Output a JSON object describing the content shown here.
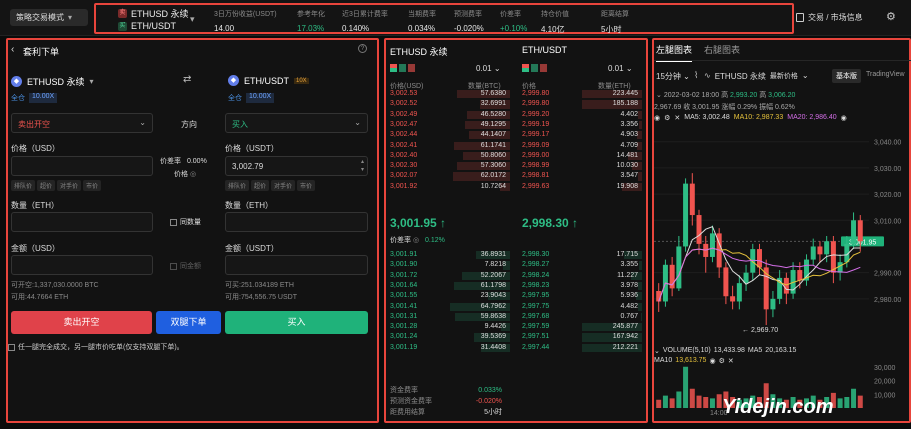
{
  "topbar": {
    "mode": "策略交易模式",
    "pair1_tag": "卖",
    "pair1": "ETHUSD 永续",
    "pair2_tag": "买",
    "pair2": "ETH/USDT",
    "stats": [
      {
        "label": "3日万份收益(USDT)",
        "value": "14.00",
        "color": "#e8e8e8"
      },
      {
        "label": "参考年化",
        "value": "17.03%",
        "color": "#2ebd85"
      },
      {
        "label": "近3日累计费率",
        "value": "0.140%",
        "color": "#e8e8e8"
      },
      {
        "label": "当期费率",
        "value": "0.034%",
        "color": "#e8e8e8"
      },
      {
        "label": "预测费率",
        "value": "-0.020%",
        "color": "#e8e8e8"
      },
      {
        "label": "价差率",
        "value": "+0.10%",
        "color": "#2ebd85"
      },
      {
        "label": "持仓价值",
        "value": "4.10亿",
        "color": "#e8e8e8"
      },
      {
        "label": "距离结算",
        "value": "5小时",
        "color": "#e8e8e8"
      }
    ],
    "market_info": "交易 / 市场信息"
  },
  "order": {
    "title": "套利下单",
    "left_pair": "ETHUSD 永续",
    "left_mode": "全仓",
    "left_lev": "10.00X",
    "right_pair": "ETH/USDT",
    "right_lev_badge": "10X",
    "right_mode": "全仓",
    "right_lev": "10.00X",
    "left_direction": "卖出开空",
    "direction_label": "方向",
    "right_direction": "买入",
    "left_price_label": "价格（USD）",
    "spread_label": "价差率",
    "spread_value": "0.00%",
    "price_label2": "价格",
    "right_price_label": "价格（USDT）",
    "right_price_value": "3,002.79",
    "left_chips": [
      "排队价",
      "超价",
      "对手价",
      "市价"
    ],
    "right_chips": [
      "排队价",
      "超价",
      "对手价",
      "市价"
    ],
    "left_qty_label": "数量（ETH）",
    "same_qty": "同数量",
    "right_qty_label": "数量（ETH）",
    "left_amt_label": "金额（USD）",
    "same_amt": "同金额",
    "right_amt_label": "金额（USDT）",
    "left_avail1": "可开空:1,337,030.0000 BTC",
    "left_avail2": "可用:44.7664 ETH",
    "right_avail1": "可买:251.034189 ETH",
    "right_avail2": "可用:754,556.75 USDT",
    "btn_sell": "卖出开空",
    "btn_both": "双腿下单",
    "btn_buy": "买入",
    "note": "任一腿完全成交，另一腿市价吃单(仅支持双腿下单)。"
  },
  "orderbook": {
    "left_title": "ETHUSD 永续",
    "right_title": "ETH/USDT",
    "left_step": "0.01",
    "right_step": "0.01",
    "left_price_hdr": "价格(USD)",
    "left_qty_hdr": "数量(BTC)",
    "right_price_hdr": "价格",
    "right_qty_hdr": "数量(ETH)",
    "left_asks": [
      [
        "3,002.53",
        "57.6380"
      ],
      [
        "3,002.52",
        "32.6991"
      ],
      [
        "3,002.49",
        "46.5280"
      ],
      [
        "3,002.47",
        "49.1295"
      ],
      [
        "3,002.44",
        "44.1407"
      ],
      [
        "3,002.41",
        "61.1741"
      ],
      [
        "3,002.40",
        "50.8060"
      ],
      [
        "3,002.30",
        "57.3060"
      ],
      [
        "3,002.07",
        "62.0172"
      ],
      [
        "3,001.92",
        "10.7264"
      ]
    ],
    "right_asks": [
      [
        "2,999.80",
        "223.445"
      ],
      [
        "2,999.80",
        "185.188"
      ],
      [
        "2,999.20",
        "4.402"
      ],
      [
        "2,999.19",
        "3.356"
      ],
      [
        "2,999.17",
        "4.903"
      ],
      [
        "2,999.09",
        "4.709"
      ],
      [
        "2,999.00",
        "14.481"
      ],
      [
        "2,998.99",
        "10.030"
      ],
      [
        "2,998.81",
        "3.547"
      ],
      [
        "2,999.63",
        "19.908"
      ]
    ],
    "left_last": "3,001.95 ↑",
    "right_last": "2,998.30 ↑",
    "spread_label": "价差率",
    "spread_value": "0.12%",
    "left_bids": [
      [
        "3,001.91",
        "36.8931"
      ],
      [
        "3,001.90",
        "7.8218"
      ],
      [
        "3,001.72",
        "52.2067"
      ],
      [
        "3,001.64",
        "61.1798"
      ],
      [
        "3,001.55",
        "23.9043"
      ],
      [
        "3,001.41",
        "64.7962"
      ],
      [
        "3,001.31",
        "59.8638"
      ],
      [
        "3,001.28",
        "9.4426"
      ],
      [
        "3,001.24",
        "39.5369"
      ],
      [
        "3,001.19",
        "31.4408"
      ]
    ],
    "right_bids": [
      [
        "2,998.30",
        "17.715"
      ],
      [
        "2,998.27",
        "3.355"
      ],
      [
        "2,998.24",
        "11.227"
      ],
      [
        "2,998.23",
        "3.978"
      ],
      [
        "2,997.95",
        "5.936"
      ],
      [
        "2,997.75",
        "4.482"
      ],
      [
        "2,997.68",
        "0.767"
      ],
      [
        "2,997.59",
        "245.877"
      ],
      [
        "2,997.51",
        "167.942"
      ],
      [
        "2,997.44",
        "212.221"
      ]
    ],
    "funding_label": "资金费率",
    "funding_value": "0.033%",
    "pred_label": "预测资金费率",
    "pred_value": "-0.020%",
    "settle_label": "距费用结算",
    "settle_value": "5小时"
  },
  "chart": {
    "tab_left": "左腿图表",
    "tab_right": "右腿图表",
    "interval": "15分钟",
    "symbol": "ETHUSD 永续",
    "price_type": "最新价格",
    "view_basic": "基本版",
    "view_tv": "TradingView",
    "ohlc_date": "2022-03-02 18:00",
    "ohlc_high_label": "高",
    "ohlc_high": "2,993.20",
    "ohlc_low_label": "高",
    "ohlc_low": "3,006.20",
    "ohlc_line2": "2,967.69  收 3,001.95  涨幅 0.29%  振幅 0.62%",
    "ma5": "MA5: 3,002.48",
    "ma10": "MA10: 2,987.33",
    "ma20": "MA20: 2,986.40",
    "price_ticks": [
      "3,040.00",
      "3,030.00",
      "3,020.00",
      "3,010.00",
      "3,001.95",
      "2,990.00",
      "2,980.00"
    ],
    "low_marker": "← 2,969.70",
    "vol_label": "VOLUME(5,10)",
    "vol_value": "13,433.98",
    "vol_ma5_label": "MA5",
    "vol_ma5": "20,163.15",
    "vol_ma10_label": "MA10",
    "vol_ma10": "13,613.75",
    "vol_ticks": [
      "30,000",
      "20,000",
      "10,000"
    ],
    "time_tick": "14:00",
    "candles": [
      [
        2983,
        2979,
        2986,
        2975
      ],
      [
        2979,
        2993,
        2995,
        2977
      ],
      [
        2993,
        2984,
        2996,
        2981
      ],
      [
        2984,
        3000,
        3004,
        2983
      ],
      [
        3000,
        3024,
        3026,
        2998
      ],
      [
        3024,
        3012,
        3028,
        3008
      ],
      [
        3012,
        3001,
        3014,
        2997
      ],
      [
        3001,
        2996,
        3004,
        2990
      ],
      [
        2996,
        3005,
        3008,
        2994
      ],
      [
        3005,
        2992,
        3007,
        2988
      ],
      [
        2992,
        2981,
        2994,
        2978
      ],
      [
        2981,
        2979,
        2985,
        2976
      ],
      [
        2979,
        2986,
        2989,
        2976
      ],
      [
        2986,
        2990,
        2993,
        2983
      ],
      [
        2990,
        2999,
        3001,
        2987
      ],
      [
        2999,
        2992,
        3001,
        2989
      ],
      [
        2992,
        2976,
        2995,
        2970
      ],
      [
        2976,
        2980,
        2983,
        2973
      ],
      [
        2980,
        2988,
        2991,
        2978
      ],
      [
        2988,
        2982,
        2990,
        2978
      ],
      [
        2982,
        2991,
        2994,
        2980
      ],
      [
        2991,
        2987,
        2994,
        2984
      ],
      [
        2987,
        2995,
        2997,
        2985
      ],
      [
        2995,
        3000,
        3003,
        2993
      ],
      [
        3000,
        2997,
        3002,
        2994
      ],
      [
        2997,
        3002,
        3004,
        2994
      ],
      [
        3002,
        2990,
        3004,
        2986
      ],
      [
        2990,
        2994,
        2997,
        2987
      ],
      [
        2994,
        3001,
        3004,
        2992
      ],
      [
        3001,
        3010,
        3013,
        2999
      ],
      [
        3010,
        3002,
        3012,
        2998
      ]
    ],
    "volumes": [
      6,
      9,
      7,
      12,
      30,
      14,
      9,
      8,
      7,
      10,
      12,
      8,
      6,
      7,
      9,
      8,
      18,
      10,
      7,
      6,
      8,
      6,
      7,
      9,
      6,
      8,
      11,
      7,
      8,
      14,
      9
    ]
  },
  "watermark": "Yidejin.com"
}
